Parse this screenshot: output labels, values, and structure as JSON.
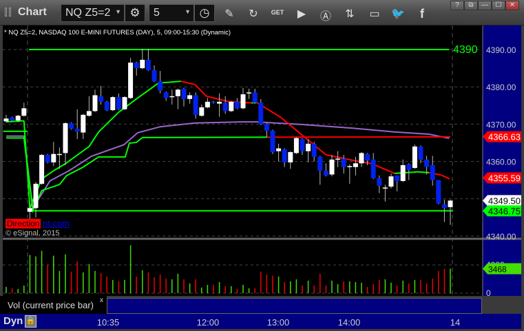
{
  "window": {
    "title": "Chart",
    "symbol": "NQ Z5=2",
    "interval": "5",
    "buttons": [
      "?",
      "⧉",
      "—",
      "☐",
      "✕"
    ]
  },
  "toolbar_icons": [
    "settings-icon",
    "clock-icon",
    "pencil-icon",
    "refresh-icon",
    "get-icon",
    "play-icon",
    "alert-icon",
    "link-icon",
    "comment-icon",
    "twitter-icon",
    "facebook-icon"
  ],
  "chart": {
    "legend": "* NQ Z5=2, NASDAQ 100 E-MINI FUTURES (DAY), 5, 09:00-15:30 (Dynamic)",
    "direction_label": "Direction",
    "link_text": "nt.com",
    "copyright": "© eSignal, 2015",
    "level_label": "4390",
    "price_ticks": [
      "4390.00",
      "4380.00",
      "4370.00",
      "4360.00",
      "4340.00"
    ],
    "price_tick_values": [
      4390,
      4380,
      4370,
      4360,
      4340
    ],
    "price_tags": [
      {
        "text": "4366.63",
        "value": 4366.63,
        "bg": "#ff0000",
        "fg": "#ffffff"
      },
      {
        "text": "4355.59",
        "value": 4355.59,
        "bg": "#ff0000",
        "fg": "#ffffff"
      },
      {
        "text": "4349.50",
        "value": 4349.5,
        "bg": "#ffffff",
        "fg": "#000000"
      },
      {
        "text": "4346.75",
        "value": 4346.75,
        "bg": "#00ff00",
        "fg": "#000000"
      }
    ],
    "vol_ticks": [
      "4000",
      "0"
    ],
    "vol_tag": "3468",
    "vol_label": "Vol (current price bar)",
    "vol_close": "x",
    "time_labels": [
      "10:35",
      "12:00",
      "13:00",
      "14:00",
      "14"
    ],
    "dyn": "Dyn"
  },
  "chart_data": {
    "type": "candlestick",
    "ylim": [
      4340,
      4392
    ],
    "ohlc": [
      [
        4370.75,
        4372.5,
        4370.5,
        4371.5
      ],
      [
        4371.75,
        4372,
        4370.75,
        4371
      ],
      [
        4371,
        4372.5,
        4370.5,
        4372.25
      ],
      [
        4372.25,
        4375.75,
        4372,
        4374.25
      ],
      [
        4346.5,
        4348,
        4344.25,
        4347.5
      ],
      [
        4347.5,
        4354.5,
        4345,
        4354
      ],
      [
        4354,
        4362,
        4353.75,
        4361.75
      ],
      [
        4361.75,
        4362,
        4359.5,
        4359.75
      ],
      [
        4359.75,
        4365.25,
        4358.75,
        4362
      ],
      [
        4361.75,
        4363.75,
        4358,
        4362
      ],
      [
        4362.25,
        4370.5,
        4359,
        4370.25
      ],
      [
        4370.25,
        4370.5,
        4368.5,
        4368.75
      ],
      [
        4368.75,
        4374,
        4366,
        4368
      ],
      [
        4367.75,
        4372.75,
        4366,
        4372.5
      ],
      [
        4372.25,
        4377.5,
        4372,
        4373.5
      ],
      [
        4373.5,
        4379.25,
        4373.25,
        4377.75
      ],
      [
        4377.5,
        4380.25,
        4375.25,
        4376
      ],
      [
        4376,
        4376.25,
        4373.5,
        4373.75
      ],
      [
        4373.75,
        4377.5,
        4373.5,
        4377.25
      ],
      [
        4377.25,
        4378.25,
        4373.75,
        4374
      ],
      [
        4374,
        4377.5,
        4373.75,
        4377.25
      ],
      [
        4377,
        4387.75,
        4376.75,
        4386.5
      ],
      [
        4386.5,
        4386.75,
        4383,
        4385
      ],
      [
        4385,
        4390.25,
        4384.75,
        4387.25
      ],
      [
        4387.25,
        4390.25,
        4384.25,
        4384.5
      ],
      [
        4384.5,
        4385.75,
        4381.25,
        4381.5
      ],
      [
        4381.5,
        4384.25,
        4378.25,
        4379
      ],
      [
        4378.5,
        4378.75,
        4376.25,
        4377
      ],
      [
        4377.25,
        4379.25,
        4375.25,
        4377.5
      ],
      [
        4377.5,
        4379.5,
        4374,
        4379.25
      ],
      [
        4379.5,
        4379.75,
        4374.75,
        4376.75
      ],
      [
        4376.75,
        4378.5,
        4375.5,
        4377.75
      ],
      [
        4377.75,
        4378.5,
        4371.5,
        4372.5
      ],
      [
        4372.25,
        4375.25,
        4372,
        4374.5
      ],
      [
        4374.5,
        4377,
        4374.25,
        4376
      ],
      [
        4376,
        4376.25,
        4375.5,
        4375.75
      ],
      [
        4375.5,
        4378.25,
        4372,
        4376
      ],
      [
        4375.75,
        4377.5,
        4372.75,
        4373.5
      ],
      [
        4373.5,
        4376.25,
        4373.25,
        4376
      ],
      [
        4376,
        4377,
        4374,
        4374.25
      ],
      [
        4374.25,
        4379.75,
        4374,
        4378
      ],
      [
        4378.25,
        4379.5,
        4376.75,
        4378.5
      ],
      [
        4378.5,
        4379.5,
        4375.5,
        4375.75
      ],
      [
        4375.75,
        4376.75,
        4369.75,
        4370
      ],
      [
        4370,
        4370.25,
        4366.5,
        4368.25
      ],
      [
        4368.25,
        4368.5,
        4362,
        4362.5
      ],
      [
        4362.75,
        4364.75,
        4360,
        4363.5
      ],
      [
        4363.25,
        4363.5,
        4358.5,
        4359.75
      ],
      [
        4359.75,
        4362.75,
        4358,
        4362.5
      ],
      [
        4362.25,
        4366.5,
        4362,
        4366.25
      ],
      [
        4366,
        4366.25,
        4361.75,
        4362.75
      ],
      [
        4362.75,
        4366,
        4359.75,
        4364.75
      ],
      [
        4364.75,
        4365.25,
        4360,
        4361.25
      ],
      [
        4361.25,
        4361.5,
        4353.75,
        4357.5
      ],
      [
        4357.5,
        4359.5,
        4356,
        4356.25
      ],
      [
        4356.5,
        4361.75,
        4356,
        4360.5
      ],
      [
        4360.5,
        4362.75,
        4358.5,
        4360.75
      ],
      [
        4360.75,
        4361.75,
        4356.75,
        4358.5
      ],
      [
        4358.5,
        4359.25,
        4354,
        4358.75
      ],
      [
        4358.5,
        4361.25,
        4356.25,
        4359.5
      ],
      [
        4359.5,
        4362.5,
        4358.5,
        4362.25
      ],
      [
        4362,
        4362.25,
        4359,
        4360.25
      ],
      [
        4360.5,
        4362.25,
        4355.25,
        4355.5
      ],
      [
        4355.5,
        4356.25,
        4351.5,
        4353.5
      ],
      [
        4352.75,
        4353.75,
        4349.25,
        4353
      ],
      [
        4353.25,
        4356.75,
        4352.75,
        4356
      ],
      [
        4356.25,
        4356.25,
        4352,
        4354.75
      ],
      [
        4354.75,
        4360.5,
        4354.5,
        4359
      ],
      [
        4359.25,
        4359.5,
        4355,
        4357.75
      ],
      [
        4358.25,
        4364.5,
        4358,
        4364
      ],
      [
        4364,
        4364.25,
        4359.5,
        4360.5
      ],
      [
        4360.5,
        4361.5,
        4356.5,
        4358.5
      ],
      [
        4359,
        4361.5,
        4353.5,
        4355
      ],
      [
        4355,
        4355,
        4348.5,
        4348.75
      ],
      [
        4348.5,
        4349.75,
        4343.75,
        4347.5
      ],
      [
        4347.75,
        4349.75,
        4343,
        4349.5
      ]
    ],
    "fast_ma": [
      [
        0,
        4370.6
      ],
      [
        3,
        4370.9
      ],
      [
        4,
        4347.5
      ],
      [
        6,
        4355.3
      ],
      [
        8,
        4357.5
      ],
      [
        10,
        4359.4
      ],
      [
        14,
        4364
      ],
      [
        15.6,
        4367.9
      ],
      [
        19,
        4373.2
      ],
      [
        22.2,
        4377
      ],
      [
        25.7,
        4381
      ],
      [
        29.5,
        4381.5
      ],
      [
        31.9,
        4380.6
      ],
      [
        33.8,
        4377.5
      ],
      [
        37.7,
        4376
      ],
      [
        41.4,
        4375.7
      ],
      [
        42.3,
        4375.8
      ],
      [
        46.3,
        4371.9
      ],
      [
        50.1,
        4366.9
      ],
      [
        54,
        4361.8
      ],
      [
        57.9,
        4360.5
      ],
      [
        61.7,
        4359.4
      ],
      [
        65.6,
        4356.8
      ],
      [
        69.5,
        4357.2
      ],
      [
        71.4,
        4357
      ],
      [
        73.4,
        4356.4
      ],
      [
        74.9,
        4355.3
      ]
    ],
    "purple_ma": [
      [
        0,
        4366.8
      ],
      [
        3,
        4366.8
      ],
      [
        4.5,
        4347.5
      ],
      [
        7.4,
        4354.8
      ],
      [
        10.6,
        4357.5
      ],
      [
        14.4,
        4361.4
      ],
      [
        19.9,
        4364.5
      ],
      [
        22.2,
        4367.7
      ],
      [
        26,
        4369.3
      ],
      [
        31.9,
        4370.3
      ],
      [
        39.7,
        4370.6
      ],
      [
        42.3,
        4370.6
      ],
      [
        50.1,
        4369.9
      ],
      [
        57.9,
        4369
      ],
      [
        65.6,
        4367.9
      ],
      [
        71.4,
        4367.3
      ],
      [
        74.8,
        4366.2
      ]
    ],
    "step_line": [
      [
        0,
        4366.3
      ],
      [
        3,
        4366.3
      ],
      [
        4.5,
        4346.8
      ],
      [
        6,
        4352.2
      ],
      [
        9,
        4353.8
      ],
      [
        10.2,
        4356.2
      ],
      [
        12.9,
        4358.4
      ],
      [
        15.6,
        4361.2
      ],
      [
        20.1,
        4361.2
      ],
      [
        20.8,
        4364.9
      ],
      [
        22,
        4365.1
      ],
      [
        23,
        4366.4
      ],
      [
        44,
        4366.5
      ],
      [
        75,
        4366.6
      ]
    ],
    "step_line_red_from": 44,
    "short_line": [
      [
        -0.5,
        4368.1
      ],
      [
        3.6,
        4368.1
      ]
    ],
    "support": 4346.75,
    "resistance": 4390,
    "volume": [
      885,
      690,
      590,
      1080,
      5410,
      5210,
      6000,
      4030,
      5310,
      3150,
      5510,
      3050,
      4520,
      2950,
      4130,
      3150,
      2850,
      2360,
      1870,
      1670,
      1870,
      6790,
      2360,
      3250,
      2950,
      2260,
      2660,
      2070,
      1970,
      2750,
      1970,
      1380,
      1970,
      790,
      1180,
      1180,
      1570,
      980,
      980,
      590,
      1180,
      690,
      690,
      3050,
      2660,
      2460,
      2360,
      1570,
      1670,
      1970,
      1080,
      1770,
      1080,
      2750,
      1080,
      1770,
      1280,
      1670,
      1670,
      1570,
      1480,
      885,
      1280,
      1870,
      1970,
      1480,
      1080,
      1770,
      1380,
      1870,
      1870,
      1380,
      2070,
      3150,
      3440,
      3468
    ],
    "volume_colors": "grgggggrgggrrgggrrgrggrgrrrrggrgrggrgrgrggrrrrgrggrgrrrggrgggrrrggrgrgrrrrrg"
  },
  "colors": {
    "up_candle": "#ffffff",
    "down_candle": "#0022ee",
    "up_vol": "#44dd00",
    "down_vol": "#ee0000",
    "axis_bg": "#000080",
    "green": "#00ff00",
    "red": "#ff0000",
    "purple": "#9966cc"
  }
}
